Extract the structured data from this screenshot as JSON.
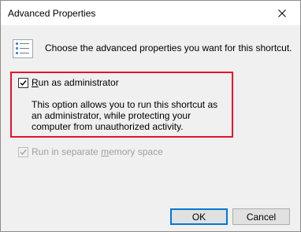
{
  "window": {
    "title": "Advanced Properties"
  },
  "icons": {
    "properties": "properties-list-icon",
    "close": "close-icon",
    "check": "checkmark-icon"
  },
  "intro_text": "Choose the advanced properties you want for this shortcut.",
  "run_as_admin": {
    "label_mnemonic": "R",
    "label_rest": "un as administrator",
    "checked": true,
    "description": "This option allows you to run this shortcut as an administrator, while protecting your computer from unauthorized activity."
  },
  "separate_memory": {
    "label_before": "Run in separate ",
    "label_mnemonic": "m",
    "label_after": "emory space",
    "checked": true,
    "enabled": false
  },
  "buttons": {
    "ok": "OK",
    "cancel": "Cancel"
  },
  "colors": {
    "highlight_border": "#e8112d",
    "default_button_border": "#0078d7",
    "dialog_bg": "#f0f0f0"
  }
}
